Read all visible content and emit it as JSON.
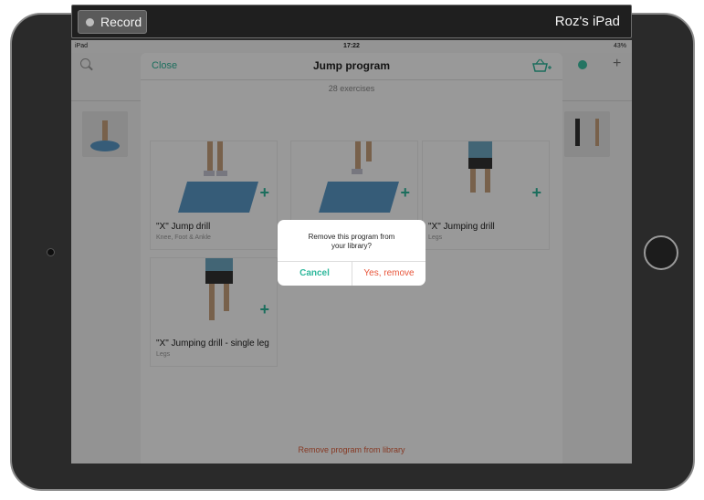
{
  "recorder": {
    "record_label": "Record",
    "device_name": "Roz's iPad"
  },
  "status_bar": {
    "device": "iPad",
    "time": "17:22",
    "battery": "43%"
  },
  "sheet": {
    "close_label": "Close",
    "title": "Jump program",
    "exercise_count": "28 exercises",
    "remove_link": "Remove program from library"
  },
  "exercises": [
    {
      "title": "\"X\" Jump drill",
      "subtitle": "Knee, Foot & Ankle"
    },
    {
      "title": "",
      "subtitle": ""
    },
    {
      "title": "\"X\" Jumping drill",
      "subtitle": "Legs"
    },
    {
      "title": "\"X\" Jumping drill - single leg",
      "subtitle": "Legs"
    }
  ],
  "alert": {
    "message_line1": "Remove this program from",
    "message_line2": "your library?",
    "cancel_label": "Cancel",
    "confirm_label": "Yes, remove"
  },
  "colors": {
    "accent": "#2fb89c",
    "destructive": "#e8553a",
    "mat": "#5a9ac8"
  }
}
